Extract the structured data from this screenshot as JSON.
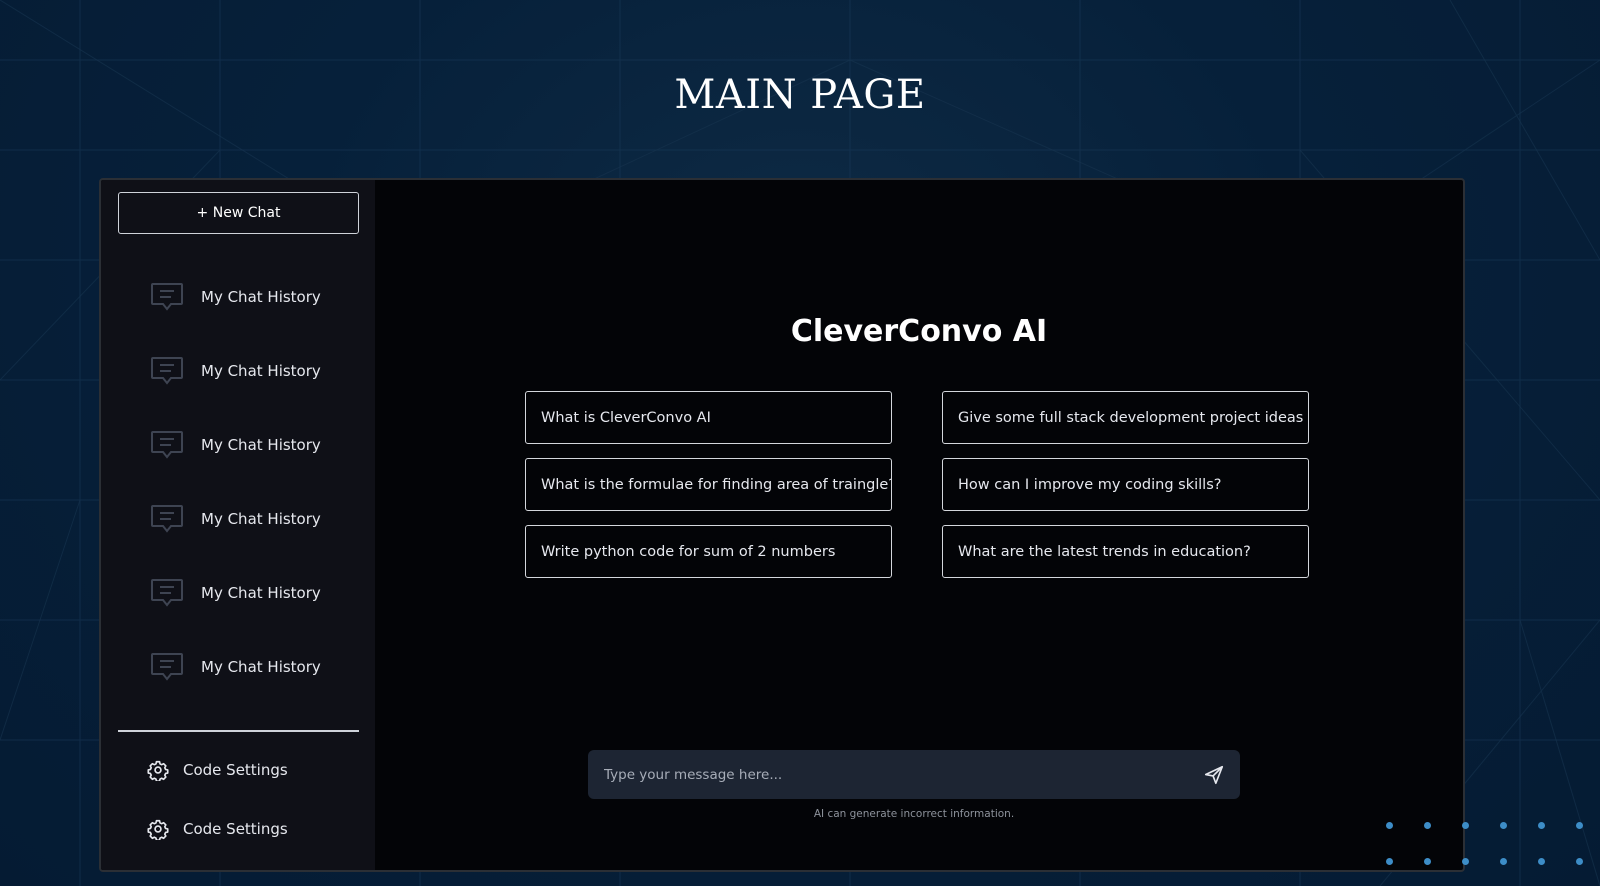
{
  "page": {
    "title": "MAIN PAGE"
  },
  "sidebar": {
    "new_chat_label": "+ New Chat",
    "history": [
      {
        "label": "My Chat History",
        "icon": "chat-bubble-icon"
      },
      {
        "label": "My Chat History",
        "icon": "chat-bubble-icon"
      },
      {
        "label": "My Chat History",
        "icon": "chat-bubble-icon"
      },
      {
        "label": "My Chat History",
        "icon": "chat-bubble-icon"
      },
      {
        "label": "My Chat History",
        "icon": "chat-bubble-icon"
      },
      {
        "label": "My Chat History",
        "icon": "chat-bubble-icon"
      }
    ],
    "settings": [
      {
        "label": "Code Settings",
        "icon": "gear-icon"
      },
      {
        "label": "Code Settings",
        "icon": "gear-icon"
      }
    ]
  },
  "main": {
    "brand": "CleverConvo AI",
    "suggestions": [
      "What is CleverConvo AI",
      "Give some full stack development project ideas",
      "What is the formulae for finding area of traingle?",
      "How can I improve my coding skills?",
      "Write python code for sum of 2 numbers",
      "What are the latest trends in education?"
    ],
    "composer": {
      "placeholder": "Type your message here...",
      "value": "",
      "send_icon": "send-icon"
    },
    "disclaimer": "AI can generate incorrect information."
  },
  "colors": {
    "background": "#06203a",
    "panel": "#030407",
    "sidebar": "#0f1017",
    "composer": "#1d2533",
    "accent_dots": "#3d8dc7"
  }
}
